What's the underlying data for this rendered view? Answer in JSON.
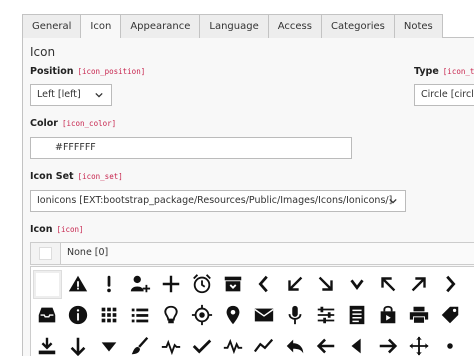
{
  "tabs": [
    {
      "label": "General"
    },
    {
      "label": "Icon"
    },
    {
      "label": "Appearance"
    },
    {
      "label": "Language"
    },
    {
      "label": "Access"
    },
    {
      "label": "Categories"
    },
    {
      "label": "Notes"
    }
  ],
  "section_title": "Icon",
  "position": {
    "label": "Position",
    "field": "[icon_position]",
    "value": "Left [left]"
  },
  "type": {
    "label": "Type",
    "field": "[icon_ty",
    "value": "Circle [circle]"
  },
  "color": {
    "label": "Color",
    "field": "[icon_color]",
    "value": "#FFFFFF"
  },
  "iconset": {
    "label": "Icon Set",
    "field": "[icon_set]",
    "value": "Ionicons [EXT:bootstrap_package/Resources/Public/Images/Icons/Ionicons/]"
  },
  "icon": {
    "label": "Icon",
    "field": "[icon]",
    "none_option": "None [0]"
  },
  "icons_row1": [
    "empty-icon",
    "alert-triangle-icon",
    "exclamation-icon",
    "person-add-icon",
    "plus-icon",
    "alarm-clock-icon",
    "archive-icon",
    "chevron-left-icon",
    "arrow-down-left-icon",
    "arrow-down-right-icon",
    "chevron-down-icon",
    "arrow-up-left-icon",
    "arrow-up-right-icon",
    "chevron-right-icon"
  ],
  "icons_row2": [
    "inbox-icon",
    "info-icon",
    "grid-icon",
    "list-icon",
    "lightbulb-icon",
    "locate-icon",
    "location-pin-icon",
    "mail-icon",
    "mic-icon",
    "sliders-icon",
    "document-icon",
    "bag-icon",
    "printer-icon",
    "pricetag-icon"
  ],
  "icons_row3": [
    "download-icon",
    "arrow-down-icon",
    "caret-down-icon",
    "brush-icon",
    "pulse-icon",
    "checkmark-icon",
    "pulse-alt-icon",
    "graph-icon",
    "reply-icon",
    "arrow-left-icon",
    "caret-left-icon",
    "arrow-right-icon",
    "move-icon",
    "bullet-icon"
  ]
}
